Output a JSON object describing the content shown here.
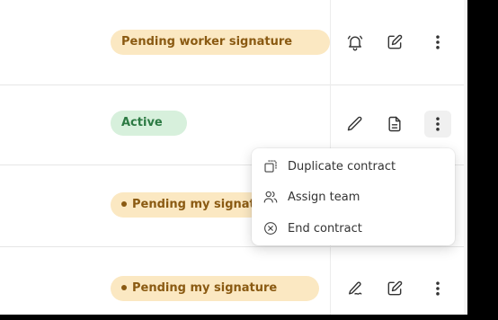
{
  "rows": [
    {
      "status": "Pending worker signature",
      "kind": "pending",
      "dot": false,
      "actions": [
        "bell-icon",
        "edit-square-icon",
        "more-vertical-icon"
      ]
    },
    {
      "status": "Active",
      "kind": "active",
      "dot": false,
      "actions": [
        "pencil-icon",
        "document-icon",
        "more-vertical-icon"
      ]
    },
    {
      "status": "Pending my signature",
      "kind": "pending",
      "dot": true,
      "actions": []
    },
    {
      "status": "Pending my signature",
      "kind": "pending",
      "dot": true,
      "actions": [
        "signature-icon",
        "edit-square-icon",
        "more-vertical-icon"
      ]
    }
  ],
  "menu": {
    "items": [
      {
        "label": "Duplicate contract",
        "icon": "duplicate-icon"
      },
      {
        "label": "Assign team",
        "icon": "users-icon"
      },
      {
        "label": "End contract",
        "icon": "circle-x-icon"
      }
    ]
  },
  "colors": {
    "pending_bg": "#fbe8c2",
    "pending_text": "#8a5a12",
    "active_bg": "#d7f0dc",
    "active_text": "#2c7a43"
  }
}
